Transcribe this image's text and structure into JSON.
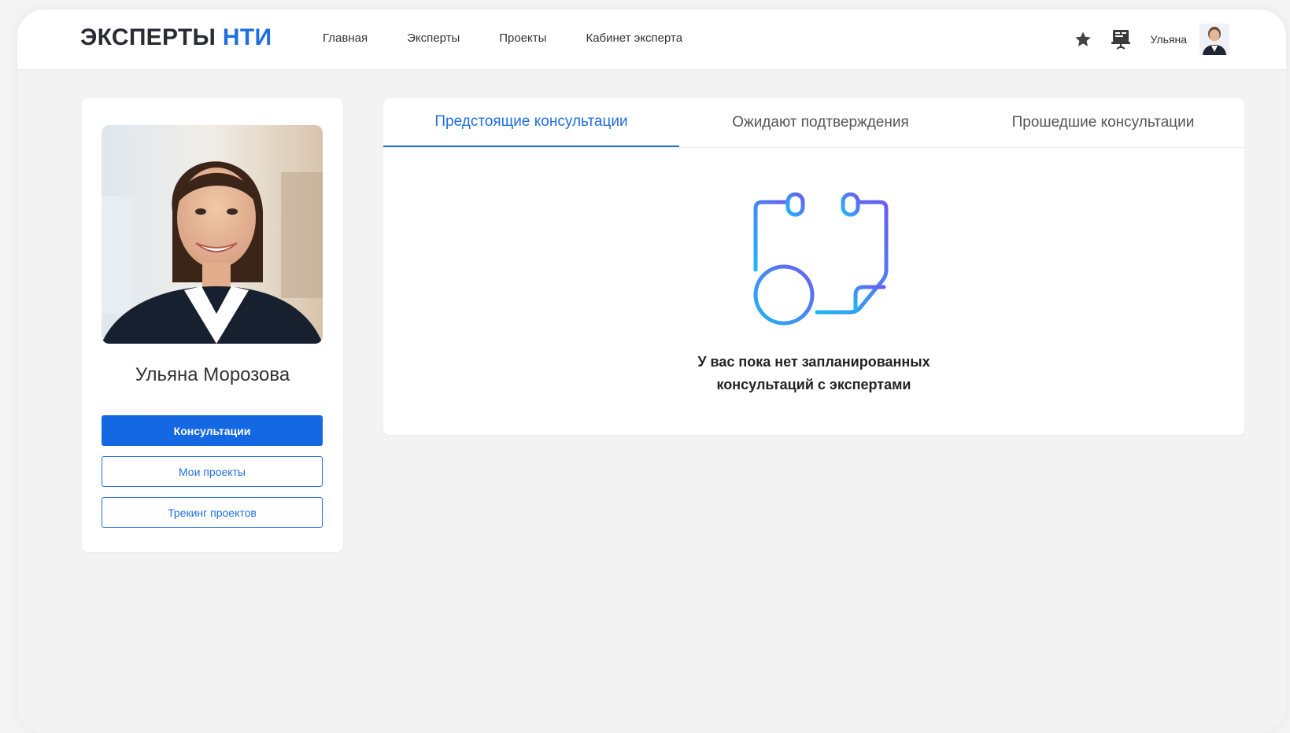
{
  "header": {
    "logo_main": "ЭКСПЕРТЫ",
    "logo_accent": "НТИ",
    "nav": [
      "Главная",
      "Эксперты",
      "Проекты",
      "Кабинет эксперта"
    ],
    "user_name": "Ульяна",
    "icons": [
      "star-icon",
      "presentation-board-icon",
      "avatar"
    ]
  },
  "profile": {
    "name": "Ульяна Морозова",
    "buttons": [
      "Консультации",
      "Мои проекты",
      "Трекинг проектов"
    ]
  },
  "tabs": [
    "Предстоящие консультации",
    "Ожидают подтверждения",
    "Прошедшие консультации"
  ],
  "empty_state": {
    "line1": "У вас пока нет запланированных",
    "line2": "консультаций с экспертами",
    "icon": "calendar-minus-icon"
  },
  "colors": {
    "accent": "#1f6fe0",
    "primary_button": "#1468e4",
    "background": "#f3f3f3",
    "gradient_start": "#1fb6f5",
    "gradient_end": "#6b5cf0"
  }
}
